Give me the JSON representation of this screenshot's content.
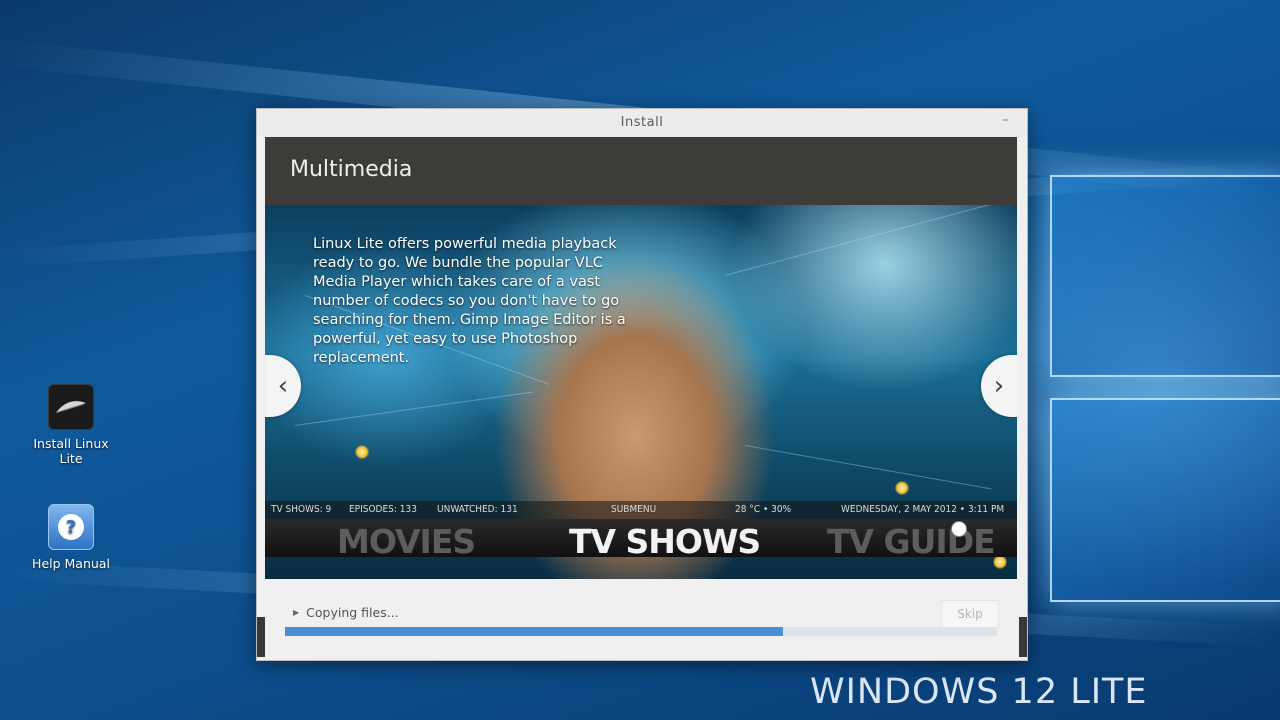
{
  "desktop": {
    "icons": [
      {
        "label": "Install Linux Lite",
        "icon": "feather-icon"
      },
      {
        "label": "Help Manual",
        "icon": "question-icon"
      }
    ],
    "watermark": "WINDOWS 12 LITE"
  },
  "installer": {
    "window_title": "Install",
    "minimize_glyph": "–",
    "section_title": "Multimedia",
    "slide": {
      "description": "Linux Lite offers powerful media playback ready to go. We bundle the popular VLC Media Player which takes care of a vast number of codecs so you don't have to go searching for them. Gimp Image Editor is a powerful, yet easy to use Photoshop replacement.",
      "kodi_status": {
        "tv_shows": "TV SHOWS: 9",
        "episodes": "EPISODES: 133",
        "unwatched": "UNWATCHED: 131",
        "submenu": "SUBMENU",
        "weather": "28 °C • 30%",
        "datetime": "WEDNESDAY, 2 MAY 2012 • 3:11 PM"
      },
      "kodi_menu": [
        "MOVIES",
        "TV SHOWS",
        "TV GUIDE"
      ]
    },
    "nav": {
      "prev": "‹",
      "next": "›"
    },
    "status_text": "Copying files...",
    "skip_label": "Skip",
    "progress_fraction": 0.7,
    "accent_color": "#4a8fd6"
  }
}
